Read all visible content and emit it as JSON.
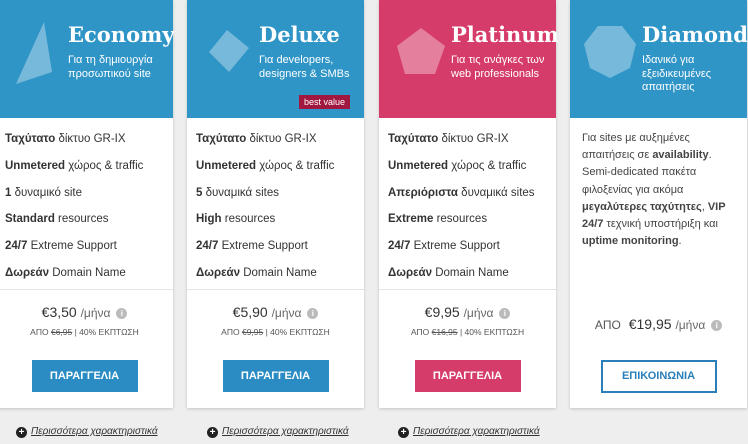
{
  "colors": {
    "blue": "#2f94c6",
    "pink": "#d63c6a",
    "button_blue": "#2b8cc4",
    "button_pink": "#d63c6a",
    "badge": "#a01840"
  },
  "plans": [
    {
      "name": "Economy",
      "desc": "Για τη δημιουργία προσωπικού site",
      "icon": "triangle-icon",
      "features": [
        {
          "b": "Ταχύτατο",
          "t": " δίκτυο GR-IX"
        },
        {
          "b": "Unmetered",
          "t": " χώρος & traffic"
        },
        {
          "b": "1",
          "t": " δυναμικό site"
        },
        {
          "b": "Standard",
          "t": " resources"
        },
        {
          "b": "24/7",
          "t": " Extreme Support"
        },
        {
          "b": "Δωρεάν",
          "t": " Domain Name"
        }
      ],
      "price": "€3,50",
      "per": "/μήνα",
      "apo": "ΑΠΟ",
      "old_price": "€6,95",
      "discount": " | 40% ΕΚΠΤΩΣΗ",
      "button": "ΠΑΡΑΓΓΕΛΙΑ",
      "more": "Περισσότερα χαρακτηριστικά"
    },
    {
      "name": "Deluxe",
      "desc": "Για developers, designers & SMBs",
      "icon": "diamond-square-icon",
      "badge": "best value",
      "features": [
        {
          "b": "Ταχύτατο",
          "t": " δίκτυο GR-IX"
        },
        {
          "b": "Unmetered",
          "t": " χώρος & traffic"
        },
        {
          "b": "5",
          "t": " δυναμικά sites"
        },
        {
          "b": "High",
          "t": " resources"
        },
        {
          "b": "24/7",
          "t": " Extreme Support"
        },
        {
          "b": "Δωρεάν",
          "t": " Domain Name"
        }
      ],
      "price": "€5,90",
      "per": "/μήνα",
      "apo": "ΑΠΟ",
      "old_price": "€9,95",
      "discount": " | 40% ΕΚΠΤΩΣΗ",
      "button": "ΠΑΡΑΓΓΕΛΙΑ",
      "more": "Περισσότερα χαρακτηριστικά"
    },
    {
      "name": "Platinum",
      "desc": "Για τις ανάγκες των web professionals",
      "icon": "pentagon-icon",
      "features": [
        {
          "b": "Ταχύτατο",
          "t": " δίκτυο GR-IX"
        },
        {
          "b": "Unmetered",
          "t": " χώρος & traffic"
        },
        {
          "b": "Απεριόριστα",
          "t": " δυναμικά sites"
        },
        {
          "b": "Extreme",
          "t": " resources"
        },
        {
          "b": "24/7",
          "t": " Extreme Support"
        },
        {
          "b": "Δωρεάν",
          "t": " Domain Name"
        }
      ],
      "price": "€9,95",
      "per": "/μήνα",
      "apo": "ΑΠΟ",
      "old_price": "€16,95",
      "discount": " | 40% ΕΚΠΤΩΣΗ",
      "button": "ΠΑΡΑΓΓΕΛΙΑ",
      "more": "Περισσότερα χαρακτηριστικά"
    },
    {
      "name": "Diamond",
      "desc": "Ιδανικό για εξειδικευμένες απαιτήσεις",
      "icon": "polygon-icon",
      "text": {
        "p1": "Για sites με αυξημένες απαιτήσεις σε ",
        "b1": "availability",
        "p2": ". Semi-dedicated πακέτα φιλοξενίας για ακόμα ",
        "b2": "μεγαλύτερες ταχύτητες",
        "p3": ", ",
        "b3": "VIP 24/7",
        "p4": " τεχνική υποστήριξη και ",
        "b4": "uptime monitoring",
        "p5": "."
      },
      "price": "€19,95",
      "per": "/μήνα",
      "apo": "ΑΠΟ",
      "button": "ΕΠΙΚΟΙΝΩΝΙΑ"
    }
  ]
}
